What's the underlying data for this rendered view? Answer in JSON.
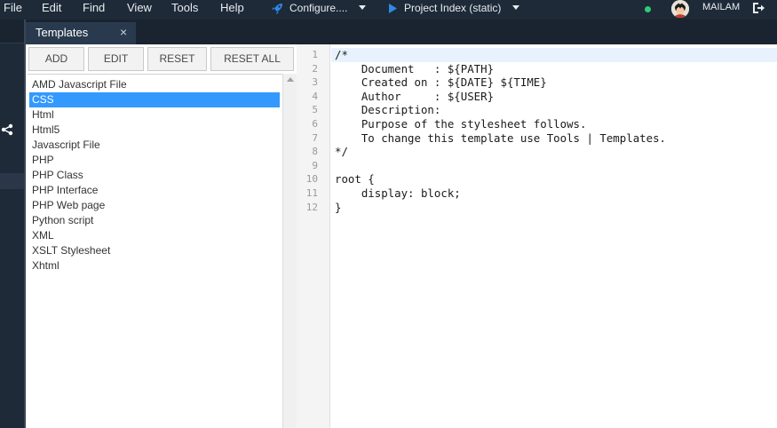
{
  "menu": {
    "items": [
      "File",
      "Edit",
      "Find",
      "View",
      "Tools",
      "Help"
    ]
  },
  "toolbar": {
    "configure_label": "Configure....",
    "project_label": "Project Index (static)",
    "accent": "#2d8ae8"
  },
  "user": {
    "name": "MAILAM",
    "status_color": "#2ecc71"
  },
  "icons": {
    "configure": "rocket-icon",
    "project": "play-icon",
    "logout": "logout-icon",
    "share": "share-icon"
  },
  "tab": {
    "title": "Templates",
    "close": "×"
  },
  "buttons": {
    "add": "ADD",
    "edit": "EDIT",
    "reset": "RESET",
    "reset_all": "RESET ALL"
  },
  "templates": {
    "selected": "CSS",
    "items": [
      "AMD Javascript File",
      "CSS",
      "Html",
      "Html5",
      "Javascript File",
      "PHP",
      "PHP Class",
      "PHP Interface",
      "PHP Web page",
      "Python script",
      "XML",
      "XSLT Stylesheet",
      "Xhtml"
    ]
  },
  "editor": {
    "line_numbers": [
      "1",
      "2",
      "3",
      "4",
      "5",
      "6",
      "7",
      "8",
      "9",
      "10",
      "11",
      "12"
    ],
    "lines": [
      "/*",
      "    Document   : ${PATH}",
      "    Created on : ${DATE} ${TIME}",
      "    Author     : ${USER}",
      "    Description:",
      "    Purpose of the stylesheet follows.",
      "    To change this template use Tools | Templates.",
      "*/",
      "",
      "root {",
      "    display: block;",
      "}"
    ]
  }
}
